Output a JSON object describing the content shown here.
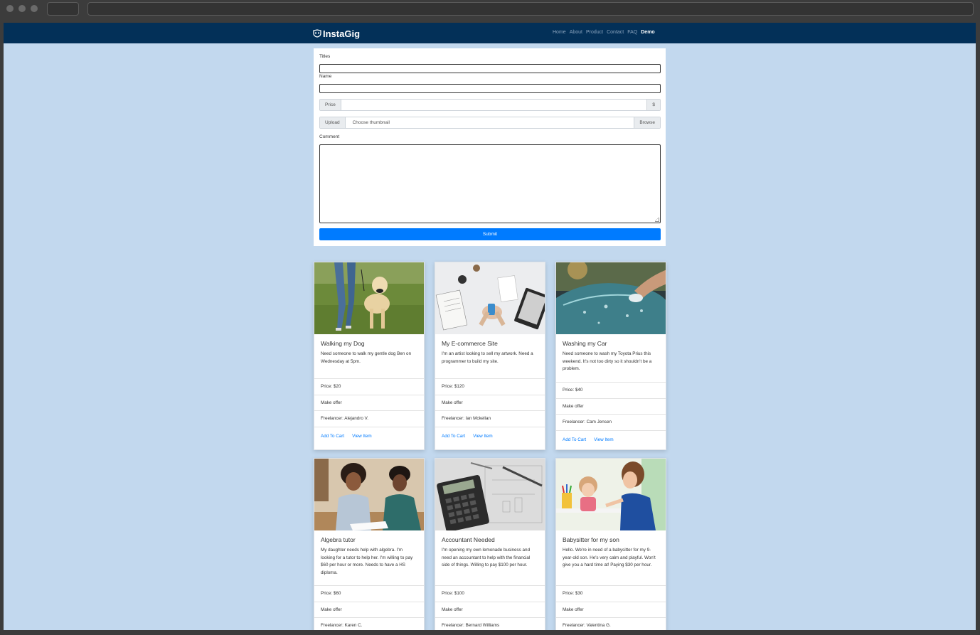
{
  "nav": {
    "brand": "InstaGig",
    "links": [
      "Home",
      "About",
      "Product",
      "Contact",
      "FAQ",
      "Demo"
    ]
  },
  "form": {
    "titles_label": "Titles",
    "name_label": "Name",
    "price_addon": "Price",
    "price_suffix": "$",
    "upload_addon": "Upload",
    "upload_placeholder": "Choose thumbnail",
    "browse_label": "Browse",
    "comment_label": "Comment",
    "submit_label": "Submit"
  },
  "cards": [
    {
      "title": "Walking my Dog",
      "text": "Need someone to walk my gentle dog Ben on Wednesday at 5pm.",
      "price": "Price: $20",
      "offer": "Make offer",
      "freelancer": "Freelancer: Alejandro V.",
      "add_to_cart": "Add To Cart",
      "view_item": "View Item",
      "image": "dog-walking-photo"
    },
    {
      "title": "My E-commerce Site",
      "text": "I'm an artist looking to sell my artwork. Need a programmer to build my site.",
      "price": "Price: $120",
      "offer": "Make offer",
      "freelancer": "Freelancer: Ian Mckellan",
      "add_to_cart": "Add To Cart",
      "view_item": "View Item",
      "image": "desk-laptop-photo"
    },
    {
      "title": "Washing my Car",
      "text": "Need someone to wash my Toyota Prius this weekend. It's not too dirty so it shouldn't be a problem.",
      "price": "Price: $40",
      "offer": "Make offer",
      "freelancer": "Freelancer: Cam Jensen",
      "add_to_cart": "Add To Cart",
      "view_item": "View Item",
      "image": "car-wash-photo"
    },
    {
      "title": "Algebra tutor",
      "text": "My daughter needs help with algebra. I'm looking for a tutor to help her. I'm willing to pay $60 per hour or more. Needs to have a HS diploma.",
      "price": "Price: $60",
      "offer": "Make offer",
      "freelancer": "Freelancer: Karen C.",
      "image": "tutoring-photo"
    },
    {
      "title": "Accountant Needed",
      "text": "I'm opening my own lemonade business and need an accountant to help with the financial side of things. Willing to pay $100 per hour.",
      "price": "Price: $100",
      "offer": "Make offer",
      "freelancer": "Freelancer: Bernard Williams",
      "image": "calculator-photo"
    },
    {
      "title": "Babysitter for my son",
      "text": "Hello. We're in need of a babysitter for my 9-year-old son. He's very calm and playful. Won't give you a hard time at! Paying $30 per hour.",
      "price": "Price: $30",
      "offer": "Make offer",
      "freelancer": "Freelancer: Valentina G.",
      "image": "babysitter-photo"
    }
  ],
  "colors": {
    "navbar": "#033058",
    "page_bg": "#c2d8ee",
    "primary": "#007bff"
  }
}
